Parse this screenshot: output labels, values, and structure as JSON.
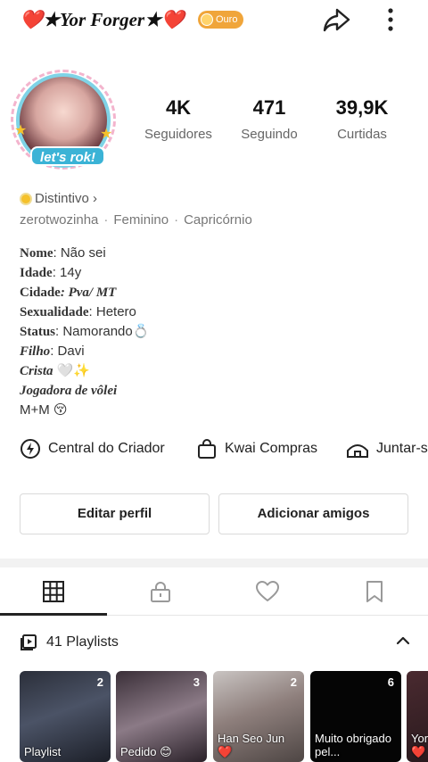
{
  "header": {
    "title": "❤️★Yor Forger★❤️",
    "badge": "Ouro"
  },
  "avatar": {
    "label": "let's rok!"
  },
  "stats": [
    {
      "value": "4K",
      "label": "Seguidores"
    },
    {
      "value": "471",
      "label": "Seguindo"
    },
    {
      "value": "39,9K",
      "label": "Curtidas"
    }
  ],
  "distintivo": "Distintivo ›",
  "meta": {
    "username": "zerotwozinha",
    "gender": "Feminino",
    "sign": "Capricórnio"
  },
  "bio": {
    "nome_k": "Nome",
    "nome_v": ": Não sei",
    "idade_k": "Idade",
    "idade_v": ": 14y",
    "cidade_k": "Cidade",
    "cidade_v": ": Pva/ MT",
    "sexualidade_k": "Sexualidade",
    "sexualidade_v": ": Hetero",
    "status_k": "Status",
    "status_v": ": Namorando💍",
    "filho_k": "Filho",
    "filho_v": ": Davi",
    "crista_k": "Crista",
    "crista_v": " 🤍✨",
    "jogadora": "Jogadora de vôlei",
    "mm": "M+M 😚"
  },
  "actions": {
    "criador": "Central do Criador",
    "compras": "Kwai Compras",
    "juntar": "Juntar-s"
  },
  "buttons": {
    "edit": "Editar perfil",
    "add": "Adicionar amigos"
  },
  "playlists": {
    "header": "41 Playlists",
    "items": [
      {
        "count": "2",
        "caption": "Playlist"
      },
      {
        "count": "3",
        "caption": "Pedido 😊"
      },
      {
        "count": "2",
        "caption": "Han Seo Jun ❤️"
      },
      {
        "count": "6",
        "caption": "Muito obrigado pel..."
      },
      {
        "count": "",
        "caption": "Yor ❤️"
      }
    ]
  },
  "colors": {
    "gold": "#f0a53a",
    "heart": "#e0182d",
    "accent_ring": "#7fd3e6"
  }
}
